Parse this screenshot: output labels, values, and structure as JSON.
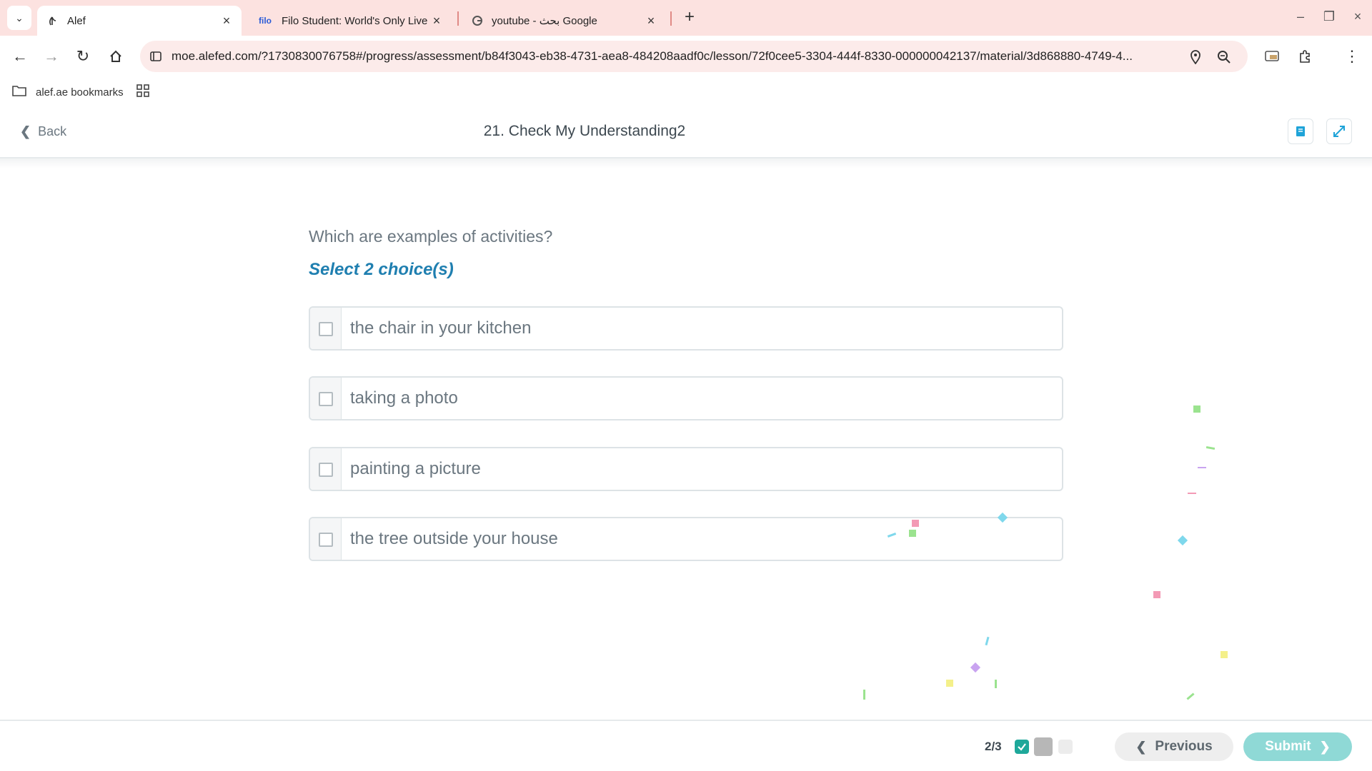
{
  "browser": {
    "tabs": [
      {
        "title": "Alef",
        "active": true
      },
      {
        "title": "Filo Student: World's Only Live I",
        "favicon_text": "filo",
        "active": false
      },
      {
        "title": "youtube - بحث Google",
        "active": false
      }
    ],
    "address": {
      "url": "moe.alefed.com/?1730830076758#/progress/assessment/b84f3043-eb38-4731-aea8-484208aadf0c/lesson/72f0cee5-3304-444f-8330-000000042137/material/3d868880-4749-4..."
    },
    "bookmarks": [
      {
        "label": "alef.ae bookmarks"
      }
    ]
  },
  "header": {
    "back_label": "Back",
    "title": "21. Check My Understanding2"
  },
  "question": {
    "prompt": "Which are examples of activities?",
    "instruction": "Select 2 choice(s)",
    "choices": [
      {
        "text": "the chair in your kitchen",
        "checked": false
      },
      {
        "text": "taking a photo",
        "checked": false
      },
      {
        "text": "painting a picture",
        "checked": false
      },
      {
        "text": "the tree outside your house",
        "checked": false
      }
    ]
  },
  "footer": {
    "progress_label": "2/3",
    "previous_label": "Previous",
    "submit_label": "Submit"
  },
  "colors": {
    "tabstrip": "#fce2e0",
    "accent_blue": "#1f7fb0",
    "submit_bg": "#8fd9d6",
    "done_green": "#1ea89a"
  }
}
